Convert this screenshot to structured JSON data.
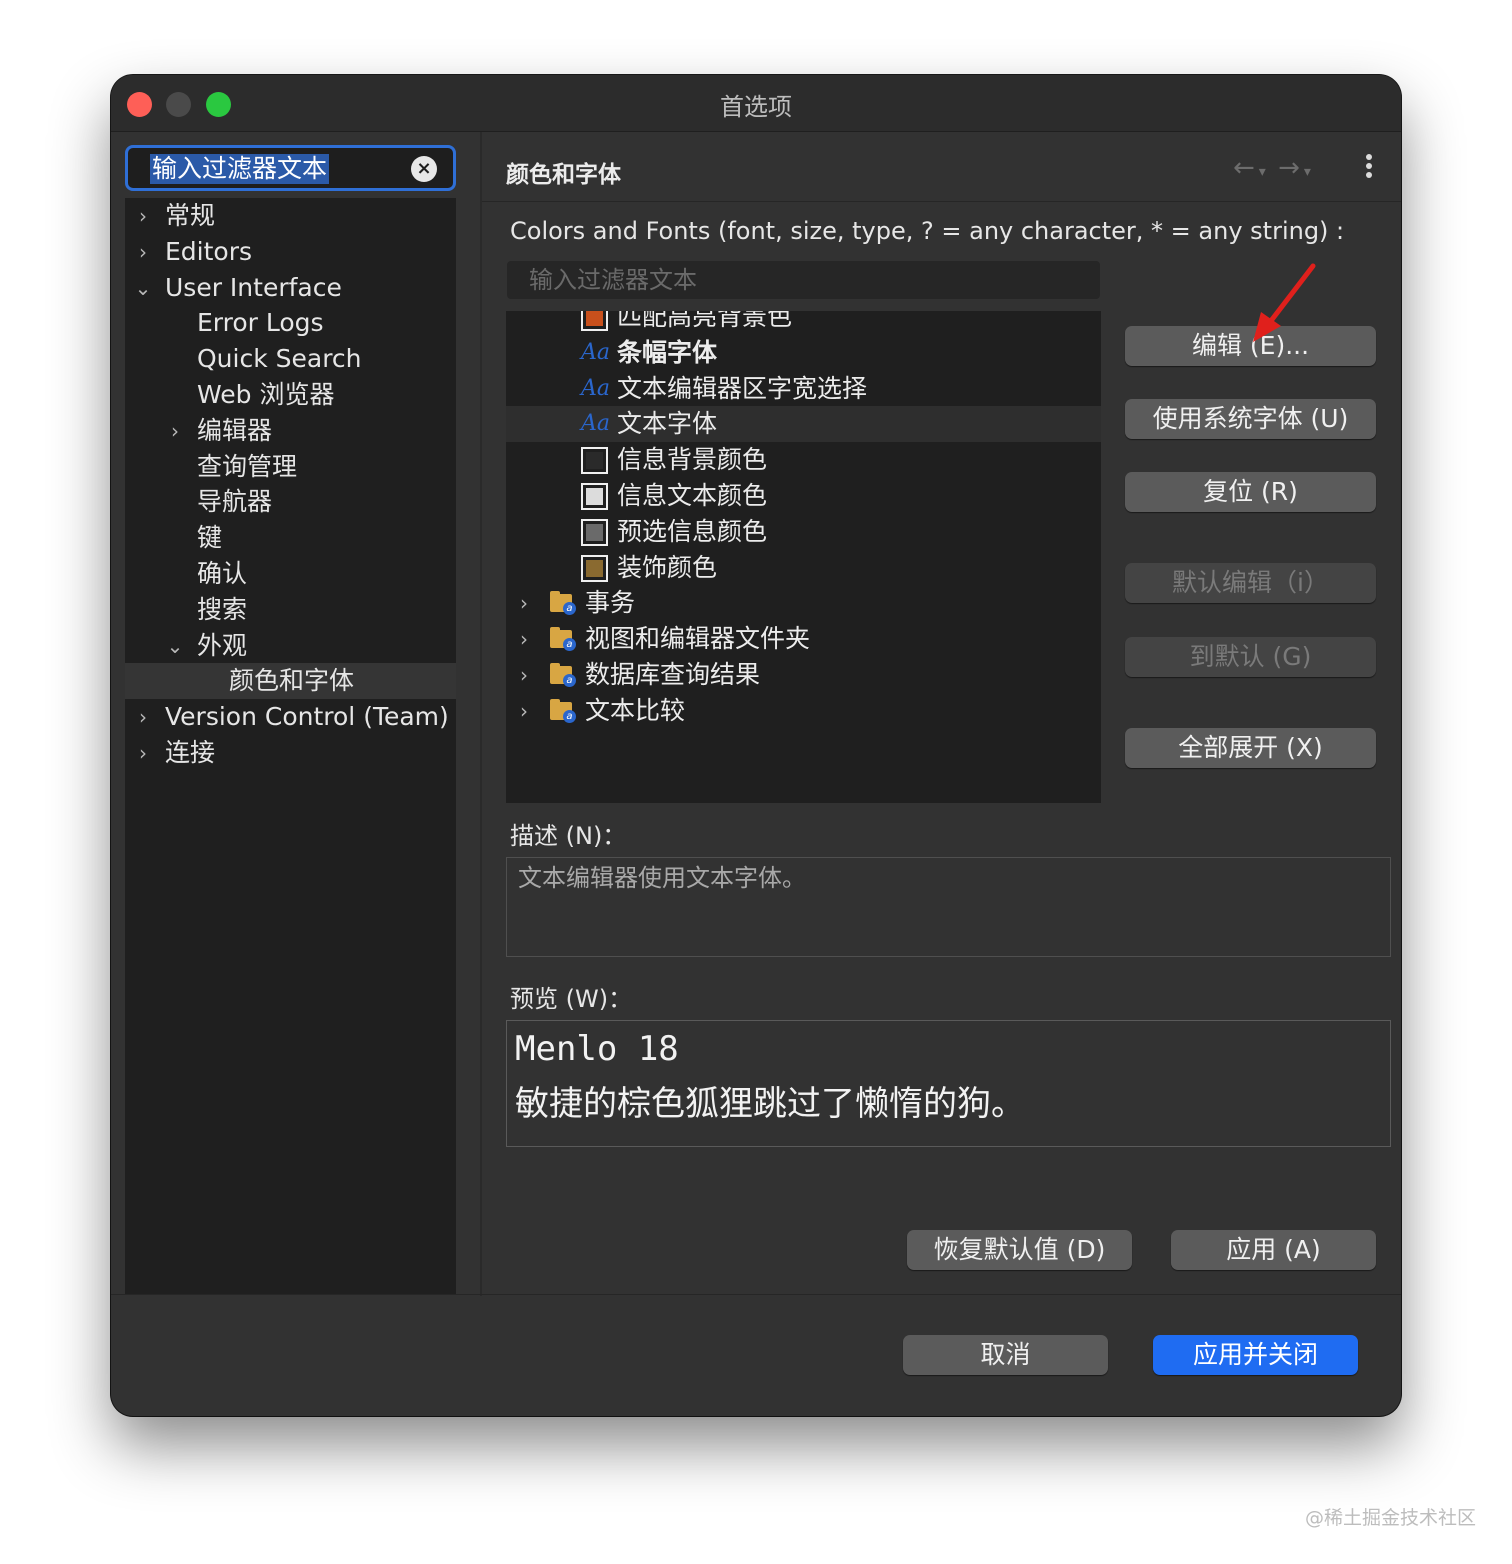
{
  "window": {
    "title": "首选项"
  },
  "sidebar": {
    "filter_text": "输入过滤器文本",
    "items": [
      {
        "label": "常规",
        "chevron": "›"
      },
      {
        "label": "Editors",
        "chevron": "›"
      },
      {
        "label": "User Interface",
        "chevron": "⌄"
      },
      {
        "label": "Error Logs",
        "chevron": ""
      },
      {
        "label": "Quick Search",
        "chevron": ""
      },
      {
        "label": "Web 浏览器",
        "chevron": ""
      },
      {
        "label": "编辑器",
        "chevron": "›"
      },
      {
        "label": "查询管理",
        "chevron": ""
      },
      {
        "label": "导航器",
        "chevron": ""
      },
      {
        "label": "键",
        "chevron": ""
      },
      {
        "label": "确认",
        "chevron": ""
      },
      {
        "label": "搜索",
        "chevron": ""
      },
      {
        "label": "外观",
        "chevron": "⌄"
      },
      {
        "label": "颜色和字体",
        "chevron": ""
      },
      {
        "label": "Version Control (Team)",
        "chevron": "›"
      },
      {
        "label": "连接",
        "chevron": "›"
      }
    ],
    "selected_item": "颜色和字体"
  },
  "page": {
    "title": "颜色和字体",
    "nav_back_icon": "←",
    "nav_forward_icon": "→",
    "description": "Colors and Fonts (font, size, type, ? = any character, * = any string) :",
    "list_filter_placeholder": "输入过滤器文本"
  },
  "font_list": {
    "items": [
      {
        "kind": "color",
        "label": "匹配高亮背景色",
        "color": "#c8501c"
      },
      {
        "kind": "font",
        "label": "条幅字体",
        "aa": "Aa",
        "bold": true
      },
      {
        "kind": "font",
        "label": "文本编辑器区字宽选择",
        "aa": "Aa"
      },
      {
        "kind": "font",
        "label": "文本字体",
        "aa": "Aa",
        "selected": true
      },
      {
        "kind": "color",
        "label": "信息背景颜色",
        "color": "#2a2a2a"
      },
      {
        "kind": "color",
        "label": "信息文本颜色",
        "color": "#dcdcdc"
      },
      {
        "kind": "color",
        "label": "预选信息颜色",
        "color": "#6a6a6a"
      },
      {
        "kind": "color",
        "label": "装饰颜色",
        "color": "#8a6a30"
      },
      {
        "kind": "category",
        "label": "事务",
        "chevron": "›"
      },
      {
        "kind": "category",
        "label": "视图和编辑器文件夹",
        "chevron": "›"
      },
      {
        "kind": "category",
        "label": "数据库查询结果",
        "chevron": "›"
      },
      {
        "kind": "category",
        "label": "文本比较",
        "chevron": "›"
      }
    ]
  },
  "buttons": {
    "edit": "编辑 (E)...",
    "use_system_font": "使用系统字体 (U)",
    "reset": "复位 (R)",
    "edit_default": "默认编辑（i）",
    "go_to_default": "到默认 (G)",
    "expand_all": "全部展开 (X)",
    "restore_defaults": "恢复默认值 (D)",
    "apply": "应用 (A)",
    "cancel": "取消",
    "apply_and_close": "应用并关闭"
  },
  "description_section": {
    "label": "描述 (N)：",
    "text": "文本编辑器使用文本字体。"
  },
  "preview_section": {
    "label": "预览 (W)：",
    "font_line": "Menlo 18",
    "sample_text": "敏捷的棕色狐狸跳过了懒惰的狗。"
  },
  "colors": {
    "accent": "#1f6cf2",
    "annotation_arrow": "#e0201c"
  },
  "watermark": "@稀土掘金技术社区"
}
